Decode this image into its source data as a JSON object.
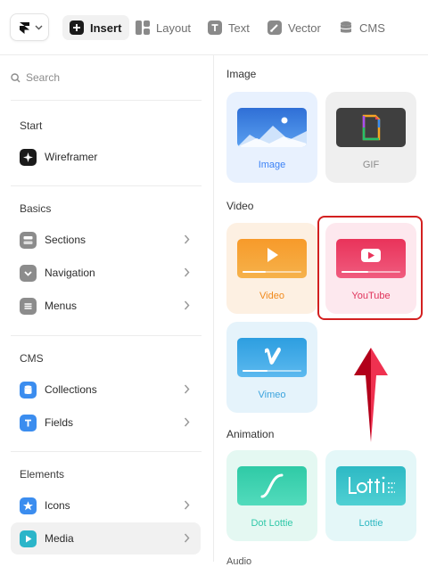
{
  "toolbar": {
    "tabs": [
      {
        "label": "Insert",
        "icon": "plus-square-icon"
      },
      {
        "label": "Layout",
        "icon": "layout-grid-icon"
      },
      {
        "label": "Text",
        "icon": "text-t-icon"
      },
      {
        "label": "Vector",
        "icon": "pen-icon"
      },
      {
        "label": "CMS",
        "icon": "database-icon"
      }
    ],
    "active_tab": "Insert"
  },
  "sidebar": {
    "search_placeholder": "Search",
    "sections": [
      {
        "title": "Start",
        "items": [
          {
            "label": "Wireframer",
            "icon": "sparkle-icon"
          }
        ]
      },
      {
        "title": "Basics",
        "items": [
          {
            "label": "Sections",
            "icon": "sections-icon"
          },
          {
            "label": "Navigation",
            "icon": "navigation-icon"
          },
          {
            "label": "Menus",
            "icon": "menus-icon"
          }
        ]
      },
      {
        "title": "CMS",
        "items": [
          {
            "label": "Collections",
            "icon": "collections-icon"
          },
          {
            "label": "Fields",
            "icon": "fields-icon"
          }
        ]
      },
      {
        "title": "Elements",
        "items": [
          {
            "label": "Icons",
            "icon": "star-icon"
          },
          {
            "label": "Media",
            "icon": "play-icon"
          }
        ]
      }
    ],
    "selected_item": "Media"
  },
  "gallery": {
    "groups": [
      {
        "title": "Image",
        "cards": [
          {
            "label": "Image",
            "label_color": "#3b82f6",
            "bg": "#e8f1fe"
          },
          {
            "label": "GIF",
            "label_color": "#8a8a8a",
            "bg": "#efefef"
          }
        ]
      },
      {
        "title": "Video",
        "cards": [
          {
            "label": "Video",
            "label_color": "#f08a1c",
            "bg": "#fdf0e2"
          },
          {
            "label": "YouTube",
            "label_color": "#e0325a",
            "bg": "#fde8ee"
          },
          {
            "label": "Vimeo",
            "label_color": "#3ba3dd",
            "bg": "#e5f3fb"
          }
        ]
      },
      {
        "title": "Animation",
        "cards": [
          {
            "label": "Dot Lottie",
            "label_color": "#31c8a9",
            "bg": "#e4f8f2"
          },
          {
            "label": "Lottie",
            "label_color": "#2eb8c2",
            "bg": "#e4f7f8"
          }
        ]
      }
    ],
    "next_group_peek": "Audio",
    "highlighted_card": "YouTube"
  },
  "colors": {
    "highlight_border": "#d32020",
    "arrow_dark": "#b2001a",
    "arrow_light": "#ef3150",
    "active_tab_bg": "#f1f1f1"
  }
}
